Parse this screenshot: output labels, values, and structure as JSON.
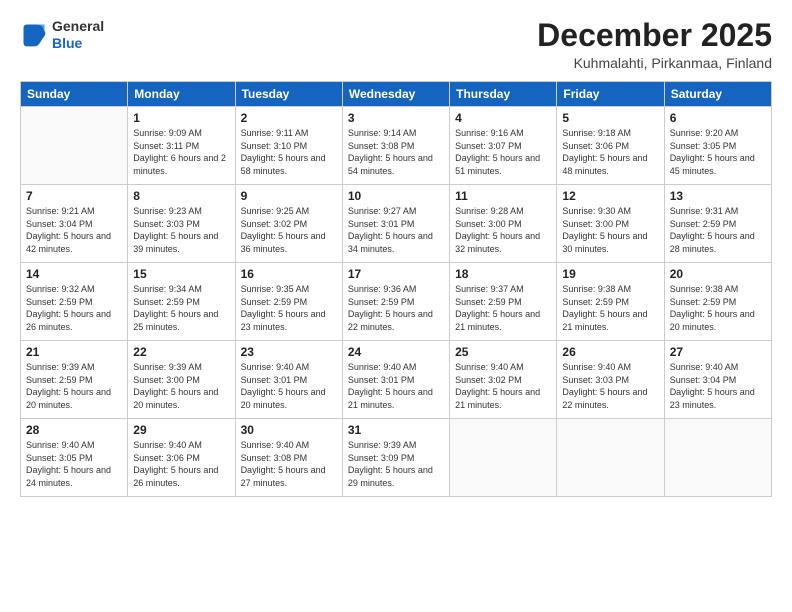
{
  "header": {
    "logo_general": "General",
    "logo_blue": "Blue",
    "title": "December 2025",
    "subtitle": "Kuhmalahti, Pirkanmaa, Finland"
  },
  "days_of_week": [
    "Sunday",
    "Monday",
    "Tuesday",
    "Wednesday",
    "Thursday",
    "Friday",
    "Saturday"
  ],
  "weeks": [
    [
      {
        "day": "",
        "info": ""
      },
      {
        "day": "1",
        "info": "Sunrise: 9:09 AM\nSunset: 3:11 PM\nDaylight: 6 hours\nand 2 minutes."
      },
      {
        "day": "2",
        "info": "Sunrise: 9:11 AM\nSunset: 3:10 PM\nDaylight: 5 hours\nand 58 minutes."
      },
      {
        "day": "3",
        "info": "Sunrise: 9:14 AM\nSunset: 3:08 PM\nDaylight: 5 hours\nand 54 minutes."
      },
      {
        "day": "4",
        "info": "Sunrise: 9:16 AM\nSunset: 3:07 PM\nDaylight: 5 hours\nand 51 minutes."
      },
      {
        "day": "5",
        "info": "Sunrise: 9:18 AM\nSunset: 3:06 PM\nDaylight: 5 hours\nand 48 minutes."
      },
      {
        "day": "6",
        "info": "Sunrise: 9:20 AM\nSunset: 3:05 PM\nDaylight: 5 hours\nand 45 minutes."
      }
    ],
    [
      {
        "day": "7",
        "info": "Sunrise: 9:21 AM\nSunset: 3:04 PM\nDaylight: 5 hours\nand 42 minutes."
      },
      {
        "day": "8",
        "info": "Sunrise: 9:23 AM\nSunset: 3:03 PM\nDaylight: 5 hours\nand 39 minutes."
      },
      {
        "day": "9",
        "info": "Sunrise: 9:25 AM\nSunset: 3:02 PM\nDaylight: 5 hours\nand 36 minutes."
      },
      {
        "day": "10",
        "info": "Sunrise: 9:27 AM\nSunset: 3:01 PM\nDaylight: 5 hours\nand 34 minutes."
      },
      {
        "day": "11",
        "info": "Sunrise: 9:28 AM\nSunset: 3:00 PM\nDaylight: 5 hours\nand 32 minutes."
      },
      {
        "day": "12",
        "info": "Sunrise: 9:30 AM\nSunset: 3:00 PM\nDaylight: 5 hours\nand 30 minutes."
      },
      {
        "day": "13",
        "info": "Sunrise: 9:31 AM\nSunset: 2:59 PM\nDaylight: 5 hours\nand 28 minutes."
      }
    ],
    [
      {
        "day": "14",
        "info": "Sunrise: 9:32 AM\nSunset: 2:59 PM\nDaylight: 5 hours\nand 26 minutes."
      },
      {
        "day": "15",
        "info": "Sunrise: 9:34 AM\nSunset: 2:59 PM\nDaylight: 5 hours\nand 25 minutes."
      },
      {
        "day": "16",
        "info": "Sunrise: 9:35 AM\nSunset: 2:59 PM\nDaylight: 5 hours\nand 23 minutes."
      },
      {
        "day": "17",
        "info": "Sunrise: 9:36 AM\nSunset: 2:59 PM\nDaylight: 5 hours\nand 22 minutes."
      },
      {
        "day": "18",
        "info": "Sunrise: 9:37 AM\nSunset: 2:59 PM\nDaylight: 5 hours\nand 21 minutes."
      },
      {
        "day": "19",
        "info": "Sunrise: 9:38 AM\nSunset: 2:59 PM\nDaylight: 5 hours\nand 21 minutes."
      },
      {
        "day": "20",
        "info": "Sunrise: 9:38 AM\nSunset: 2:59 PM\nDaylight: 5 hours\nand 20 minutes."
      }
    ],
    [
      {
        "day": "21",
        "info": "Sunrise: 9:39 AM\nSunset: 2:59 PM\nDaylight: 5 hours\nand 20 minutes."
      },
      {
        "day": "22",
        "info": "Sunrise: 9:39 AM\nSunset: 3:00 PM\nDaylight: 5 hours\nand 20 minutes."
      },
      {
        "day": "23",
        "info": "Sunrise: 9:40 AM\nSunset: 3:01 PM\nDaylight: 5 hours\nand 20 minutes."
      },
      {
        "day": "24",
        "info": "Sunrise: 9:40 AM\nSunset: 3:01 PM\nDaylight: 5 hours\nand 21 minutes."
      },
      {
        "day": "25",
        "info": "Sunrise: 9:40 AM\nSunset: 3:02 PM\nDaylight: 5 hours\nand 21 minutes."
      },
      {
        "day": "26",
        "info": "Sunrise: 9:40 AM\nSunset: 3:03 PM\nDaylight: 5 hours\nand 22 minutes."
      },
      {
        "day": "27",
        "info": "Sunrise: 9:40 AM\nSunset: 3:04 PM\nDaylight: 5 hours\nand 23 minutes."
      }
    ],
    [
      {
        "day": "28",
        "info": "Sunrise: 9:40 AM\nSunset: 3:05 PM\nDaylight: 5 hours\nand 24 minutes."
      },
      {
        "day": "29",
        "info": "Sunrise: 9:40 AM\nSunset: 3:06 PM\nDaylight: 5 hours\nand 26 minutes."
      },
      {
        "day": "30",
        "info": "Sunrise: 9:40 AM\nSunset: 3:08 PM\nDaylight: 5 hours\nand 27 minutes."
      },
      {
        "day": "31",
        "info": "Sunrise: 9:39 AM\nSunset: 3:09 PM\nDaylight: 5 hours\nand 29 minutes."
      },
      {
        "day": "",
        "info": ""
      },
      {
        "day": "",
        "info": ""
      },
      {
        "day": "",
        "info": ""
      }
    ]
  ]
}
